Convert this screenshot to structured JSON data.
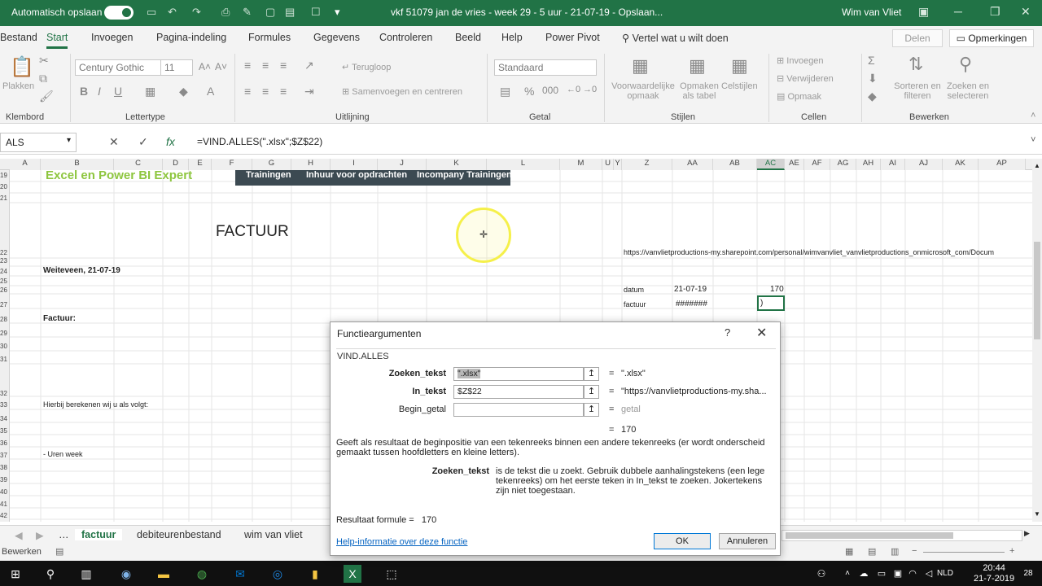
{
  "titlebar": {
    "autosave_label": "Automatisch opslaan",
    "doc_title": "vkf 51079 jan de vries - week 29 - 5 uur - 21-07-19  -  Opslaan...",
    "user": "Wim van Vliet"
  },
  "tabs": [
    "Bestand",
    "Start",
    "Invoegen",
    "Pagina-indeling",
    "Formules",
    "Gegevens",
    "Controleren",
    "Beeld",
    "Help",
    "Power Pivot"
  ],
  "active_tab": "Start",
  "tell_me": "Vertel wat u wilt doen",
  "share_label": "Delen",
  "comments_label": "Opmerkingen",
  "ribbon": {
    "groups": [
      "Klembord",
      "Lettertype",
      "Uitlijning",
      "Getal",
      "Stijlen",
      "Cellen",
      "Bewerken"
    ],
    "paste": "Plakken",
    "font_name": "Century Gothic",
    "font_size": "11",
    "wrap": "Terugloop",
    "merge": "Samenvoegen en centreren",
    "number_format": "Standaard",
    "cond_format": "Voorwaardelijke opmaak",
    "format_table": "Opmaken als tabel",
    "cell_styles": "Celstijlen",
    "insert": "Invoegen",
    "delete": "Verwijderen",
    "format": "Opmaak",
    "sort_filter": "Sorteren en filteren",
    "find_select": "Zoeken en selecteren"
  },
  "formula_bar": {
    "name_box": "ALS",
    "formula": "=VIND.ALLES(\".xlsx\";$Z$22)"
  },
  "columns": [
    "A",
    "B",
    "C",
    "D",
    "E",
    "F",
    "G",
    "H",
    "I",
    "J",
    "K",
    "L",
    "M",
    "U",
    "Y",
    "Z",
    "AA",
    "AB",
    "AC",
    "AE",
    "AF",
    "AG",
    "AH",
    "AI",
    "AJ",
    "AK",
    "AP"
  ],
  "rows": [
    "19",
    "20",
    "21",
    "22",
    "23",
    "24",
    "25",
    "26",
    "27",
    "28",
    "29",
    "30",
    "31",
    "32",
    "33",
    "34",
    "35",
    "36",
    "37",
    "38",
    "39",
    "40",
    "41",
    "42"
  ],
  "sheet": {
    "banner_text": "Excel en Power BI Expert",
    "nav_items": [
      "Trainingen",
      "Inhuur voor opdrachten",
      "Incompany Trainingen"
    ],
    "factuur_title": "FACTUUR",
    "place_date": "Weiteveen, 21-07-19",
    "factuur_label": "Factuur:",
    "hierbij": "Hierbij berekenen wij u als volgt:",
    "uren_week": "- Uren week",
    "url_cell": "https://vanvlietproductions-my.sharepoint.com/personal/wimvanvliet_vanvlietproductions_onmicrosoft_com/Docum",
    "datum_label": "datum",
    "datum_value": "21-07-19",
    "datum_count": "170",
    "factuur_small": "factuur",
    "hash_value": "#######",
    "edit_cell": ")"
  },
  "sheet_tabs": [
    "factuur",
    "debiteurenbestand",
    "wim van vliet"
  ],
  "active_sheet": "factuur",
  "status_mode": "Bewerken",
  "taskbar": {
    "lang": "NLD",
    "time": "20:44",
    "date": "21-7-2019",
    "badge": "28"
  },
  "dialog": {
    "title": "Functieargumenten",
    "help": "?",
    "function_name": "VIND.ALLES",
    "args": [
      {
        "label": "Zoeken_tekst",
        "value": "\".xlsx\"",
        "result": "\".xlsx\"",
        "bold": true
      },
      {
        "label": "In_tekst",
        "value": "$Z$22",
        "result": "\"https://vanvlietproductions-my.sha...",
        "bold": true
      },
      {
        "label": "Begin_getal",
        "value": "",
        "result": "getal",
        "bold": false
      }
    ],
    "function_result": "170",
    "description": "Geeft als resultaat de beginpositie van een tekenreeks binnen een andere tekenreeks (er wordt onderscheid gemaakt tussen hoofdletters en kleine letters).",
    "param_name": "Zoeken_tekst",
    "param_description": "is de tekst die u zoekt. Gebruik dubbele aanhalingstekens (een lege tekenreeks) om het eerste teken in In_tekst te zoeken. Jokertekens zijn niet toegestaan.",
    "result_label": "Resultaat formule =",
    "result_value": "170",
    "help_link": "Help-informatie over deze functie",
    "ok": "OK",
    "cancel": "Annuleren"
  },
  "colors": {
    "excel_green": "#217346",
    "banner_green": "#8ec63f",
    "nav_dark": "#3c4a52",
    "highlight_yellow": "#f5f04a"
  }
}
